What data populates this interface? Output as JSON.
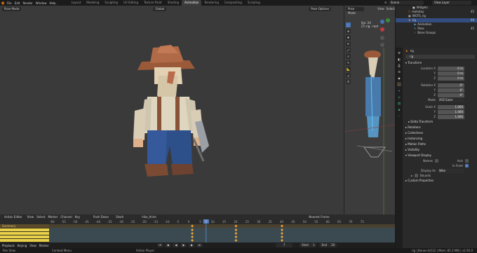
{
  "topbar": {
    "menus": [
      "File",
      "Edit",
      "Render",
      "Window",
      "Help"
    ],
    "workspace_tabs": [
      "Layout",
      "Modeling",
      "Sculpting",
      "UV Editing",
      "Texture Paint",
      "Shading",
      "Animation",
      "Rendering",
      "Compositing",
      "Scripting"
    ],
    "active_tab": "Animation",
    "scene": "Scene",
    "view_layer": "View Layer"
  },
  "viewport": {
    "mode": "Pose Mode",
    "transform": "Global",
    "menus": [
      "View",
      "Select",
      "Pose"
    ],
    "pose_options": "Pose Options",
    "gizmo_label": "Z"
  },
  "viewport2": {
    "mode": "Pose Mode",
    "menus": [
      "View",
      "Select"
    ],
    "info_line1": "fps: 24",
    "info_line2": "(7) rig : root"
  },
  "outliner": {
    "rows": [
      {
        "label": "Widgets",
        "selected": false
      },
      {
        "label": "mahalay",
        "selected": false
      },
      {
        "label": "WGTS_rig",
        "selected": false
      },
      {
        "label": "rig",
        "selected": true
      },
      {
        "label": "Animation",
        "selected": false
      },
      {
        "label": "Pose",
        "selected": false
      },
      {
        "label": "Bone Groups",
        "selected": false
      }
    ],
    "counts": [
      "45",
      "68",
      "45"
    ]
  },
  "properties": {
    "object_name": "rig",
    "sections": {
      "transform": "Transform",
      "delta": "Delta Transform",
      "relations": "Relations",
      "collections": "Collections",
      "instancing": "Instancing",
      "motion_paths": "Motion Paths",
      "visibility": "Visibility",
      "viewport_display": "Viewport Display",
      "custom_props": "Custom Properties"
    },
    "location": {
      "label": "Location X",
      "x": "0 m",
      "y": "0 m",
      "z": "0 m"
    },
    "rotation": {
      "label": "Rotation X",
      "x": "0°",
      "y": "0°",
      "z": "0°"
    },
    "rotation_mode": {
      "label": "Mode",
      "value": "XYZ Euler"
    },
    "scale": {
      "label": "Scale X",
      "x": "1.000",
      "y": "1.000",
      "z": "1.000"
    },
    "axis_labels": [
      "Y",
      "Z"
    ],
    "display": {
      "names_label": "Names",
      "axis_label": "Axis",
      "in_front_label": "In Front",
      "display_as_label": "Display As",
      "display_as_value": "Wire",
      "bounds_label": "Bounds"
    }
  },
  "timeline": {
    "editor": "Action Editor",
    "menus": [
      "View",
      "Select",
      "Marker",
      "Channel",
      "Key"
    ],
    "push_down": "Push Down",
    "stash": "Stash",
    "action": "hiko_Anim",
    "nearest_frame": "Nearest Frame",
    "summary": "Summary",
    "current_frame": "7",
    "ticks": [
      "-60",
      "-55",
      "-50",
      "-45",
      "-40",
      "-35",
      "-30",
      "-25",
      "-20",
      "-15",
      "-10",
      "-5",
      "0",
      "5",
      "10",
      "15",
      "20",
      "25",
      "30",
      "35",
      "40",
      "45",
      "50",
      "55",
      "60",
      "65",
      "70",
      "75"
    ]
  },
  "playbar": {
    "items": [
      "Playback",
      "Keying",
      "View",
      "Marker"
    ],
    "frame": "7",
    "start_label": "Start",
    "start": "1",
    "end_label": "End",
    "end": "20"
  },
  "status": {
    "items": [
      "Pan View",
      "Context Menu",
      "Action Player"
    ],
    "version": "rig | Bones:4/112 | Mem: 85.3 MiB | v2.92.0"
  },
  "colors": {
    "accent": "#e87d0d",
    "select": "#4772b3",
    "keyframe": "#e8a33d",
    "playhead": "#5680c2"
  }
}
